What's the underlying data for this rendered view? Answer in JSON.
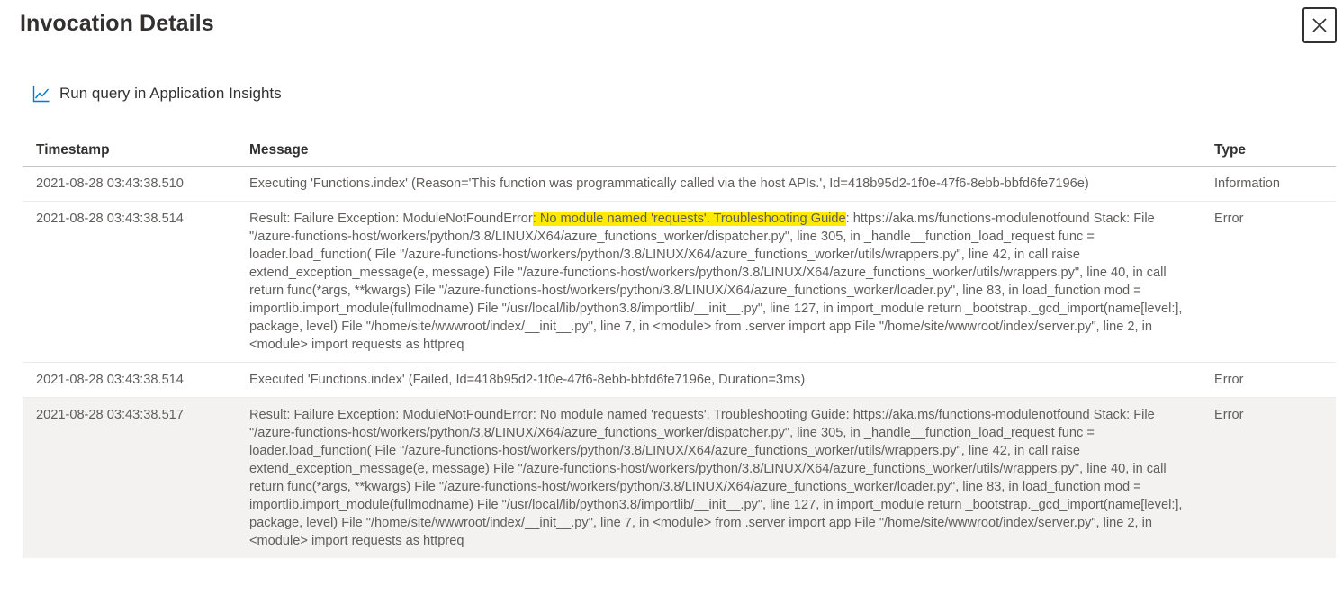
{
  "header": {
    "title": "Invocation Details",
    "close_icon": "close-icon"
  },
  "toolbar": {
    "run_query_label": "Run query in Application Insights",
    "run_query_icon": "line-chart-icon"
  },
  "table": {
    "columns": [
      "Timestamp",
      "Message",
      "Type"
    ],
    "rows": [
      {
        "timestamp": "2021-08-28 03:43:38.510",
        "message": "Executing 'Functions.index' (Reason='This function was programmatically called via the host APIs.', Id=418b95d2-1f0e-47f6-8ebb-bbfd6fe7196e)",
        "type": "Information"
      },
      {
        "timestamp": "2021-08-28 03:43:38.514",
        "message_before": "Result: Failure Exception: ModuleNotFoundError",
        "message_highlight": ": No module named 'requests'. Troubleshooting Guide",
        "message_after": ": https://aka.ms/functions-modulenotfound Stack: File \"/azure-functions-host/workers/python/3.8/LINUX/X64/azure_functions_worker/dispatcher.py\", line 305, in _handle__function_load_request func = loader.load_function( File \"/azure-functions-host/workers/python/3.8/LINUX/X64/azure_functions_worker/utils/wrappers.py\", line 42, in call raise extend_exception_message(e, message) File \"/azure-functions-host/workers/python/3.8/LINUX/X64/azure_functions_worker/utils/wrappers.py\", line 40, in call return func(*args, **kwargs) File \"/azure-functions-host/workers/python/3.8/LINUX/X64/azure_functions_worker/loader.py\", line 83, in load_function mod = importlib.import_module(fullmodname) File \"/usr/local/lib/python3.8/importlib/__init__.py\", line 127, in import_module return _bootstrap._gcd_import(name[level:], package, level) File \"/home/site/wwwroot/index/__init__.py\", line 7, in <module> from .server import app File \"/home/site/wwwroot/index/server.py\", line 2, in <module> import requests as httpreq",
        "type": "Error",
        "highlight_color": "#ffea00"
      },
      {
        "timestamp": "2021-08-28 03:43:38.514",
        "message": "Executed 'Functions.index' (Failed, Id=418b95d2-1f0e-47f6-8ebb-bbfd6fe7196e, Duration=3ms)",
        "type": "Error"
      },
      {
        "timestamp": "2021-08-28 03:43:38.517",
        "message": "Result: Failure Exception: ModuleNotFoundError: No module named 'requests'. Troubleshooting Guide: https://aka.ms/functions-modulenotfound Stack: File \"/azure-functions-host/workers/python/3.8/LINUX/X64/azure_functions_worker/dispatcher.py\", line 305, in _handle__function_load_request func = loader.load_function( File \"/azure-functions-host/workers/python/3.8/LINUX/X64/azure_functions_worker/utils/wrappers.py\", line 42, in call raise extend_exception_message(e, message) File \"/azure-functions-host/workers/python/3.8/LINUX/X64/azure_functions_worker/utils/wrappers.py\", line 40, in call return func(*args, **kwargs) File \"/azure-functions-host/workers/python/3.8/LINUX/X64/azure_functions_worker/loader.py\", line 83, in load_function mod = importlib.import_module(fullmodname) File \"/usr/local/lib/python3.8/importlib/__init__.py\", line 127, in import_module return _bootstrap._gcd_import(name[level:], package, level) File \"/home/site/wwwroot/index/__init__.py\", line 7, in <module> from .server import app File \"/home/site/wwwroot/index/server.py\", line 2, in <module> import requests as httpreq",
        "type": "Error",
        "selected": true
      }
    ]
  },
  "colors": {
    "text_primary": "#323130",
    "text_secondary": "#605e5c",
    "accent": "#0078d4",
    "selected_row": "#f3f2f1"
  }
}
